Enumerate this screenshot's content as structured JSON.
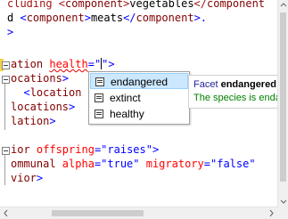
{
  "editor": {
    "lines": [
      {
        "parts": [
          [
            "tag",
            "cluding <"
          ],
          [
            "name",
            "component"
          ],
          [
            "tag",
            ">"
          ],
          [
            "txt",
            "vegetables"
          ],
          [
            "tag",
            "</"
          ],
          [
            "name",
            "component"
          ]
        ]
      },
      {
        "parts": [
          [
            "txt",
            "d "
          ],
          [
            "tag",
            "<"
          ],
          [
            "name",
            "component"
          ],
          [
            "tag",
            ">"
          ],
          [
            "txt",
            "meats"
          ],
          [
            "tag",
            "</"
          ],
          [
            "name",
            "component"
          ],
          [
            "tag",
            ">."
          ]
        ]
      },
      {
        "parts": [
          [
            "br",
            ">"
          ]
        ]
      },
      {
        "parts": [
          [
            "name",
            "ation "
          ],
          [
            "attr",
            "health"
          ],
          [
            "br",
            "=\""
          ],
          [
            "caret",
            ""
          ],
          [
            "br",
            "\">"
          ]
        ]
      },
      {
        "parts": [
          [
            "name",
            "ocations"
          ],
          [
            "br",
            ">"
          ]
        ]
      },
      {
        "parts": [
          [
            "txt",
            "  "
          ],
          [
            "br",
            "<"
          ],
          [
            "name",
            "location"
          ]
        ]
      },
      {
        "parts": [
          [
            "name",
            "locations"
          ],
          [
            "br",
            ">"
          ]
        ]
      },
      {
        "parts": [
          [
            "name",
            "lation"
          ],
          [
            "br",
            ">"
          ]
        ]
      },
      {
        "parts": [
          [
            "name",
            "ior "
          ],
          [
            "attr",
            "offspring"
          ],
          [
            "br",
            "="
          ],
          [
            "val",
            "\"raises\""
          ],
          [
            "br",
            ">"
          ]
        ]
      },
      {
        "parts": [
          [
            "name",
            "ommunal "
          ],
          [
            "attr",
            "alpha"
          ],
          [
            "br",
            "="
          ],
          [
            "val",
            "\"true\" "
          ],
          [
            "attr",
            "migratory"
          ],
          [
            "br",
            "="
          ],
          [
            "val",
            "\"false\""
          ]
        ]
      },
      {
        "parts": [
          [
            "name",
            "vior"
          ],
          [
            "br",
            ">"
          ]
        ]
      }
    ]
  },
  "completion": {
    "items": [
      {
        "label": "endangered",
        "selected": true,
        "icon": "enum-value-icon"
      },
      {
        "label": "extinct",
        "selected": false,
        "icon": "enum-value-icon"
      },
      {
        "label": "healthy",
        "selected": false,
        "icon": "enum-value-icon"
      }
    ]
  },
  "tooltip": {
    "kind": "Facet",
    "name": "endangered",
    "description": "The species is endan"
  }
}
